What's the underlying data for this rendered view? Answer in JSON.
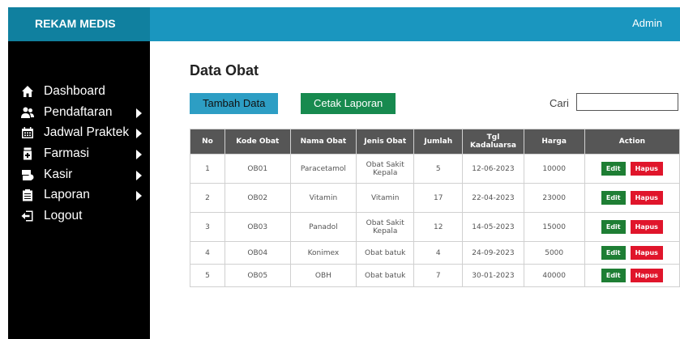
{
  "header": {
    "brand": "REKAM MEDIS",
    "user": "Admin"
  },
  "sidebar": {
    "items": [
      {
        "label": "Dashboard",
        "icon": "home-icon",
        "submenu": false
      },
      {
        "label": "Pendaftaran",
        "icon": "users-icon",
        "submenu": true
      },
      {
        "label": "Jadwal Praktek",
        "icon": "calendar-icon",
        "submenu": true
      },
      {
        "label": "Farmasi",
        "icon": "medicine-icon",
        "submenu": true
      },
      {
        "label": "Kasir",
        "icon": "cash-icon",
        "submenu": true
      },
      {
        "label": "Laporan",
        "icon": "report-icon",
        "submenu": true
      },
      {
        "label": "Logout",
        "icon": "logout-icon",
        "submenu": false
      }
    ]
  },
  "main": {
    "title": "Data Obat",
    "add_button": "Tambah Data",
    "print_button": "Cetak Laporan",
    "search_label": "Cari",
    "search_value": ""
  },
  "table": {
    "headers": [
      "No",
      "Kode Obat",
      "Nama Obat",
      "Jenis Obat",
      "Jumlah",
      "Tgl Kadaluarsa",
      "Harga",
      "Action"
    ],
    "rows": [
      {
        "no": "1",
        "kode": "OB01",
        "nama": "Paracetamol",
        "jenis": "Obat Sakit Kepala",
        "jumlah": "5",
        "tgl": "12-06-2023",
        "harga": "10000"
      },
      {
        "no": "2",
        "kode": "OB02",
        "nama": "Vitamin",
        "jenis": "Vitamin",
        "jumlah": "17",
        "tgl": "22-04-2023",
        "harga": "23000"
      },
      {
        "no": "3",
        "kode": "OB03",
        "nama": "Panadol",
        "jenis": "Obat Sakit Kepala",
        "jumlah": "12",
        "tgl": "14-05-2023",
        "harga": "15000"
      },
      {
        "no": "4",
        "kode": "OB04",
        "nama": "Konimex",
        "jenis": "Obat batuk",
        "jumlah": "4",
        "tgl": "24-09-2023",
        "harga": "5000"
      },
      {
        "no": "5",
        "kode": "OB05",
        "nama": "OBH",
        "jenis": "Obat batuk",
        "jumlah": "7",
        "tgl": "30-01-2023",
        "harga": "40000"
      }
    ],
    "edit_label": "Edit",
    "delete_label": "Hapus"
  },
  "colors": {
    "topbar": "#1a96bf",
    "brand_bg": "#10809f",
    "sidebar": "#000000",
    "table_header": "#565656",
    "edit": "#1e7e34",
    "delete": "#e0152b"
  }
}
